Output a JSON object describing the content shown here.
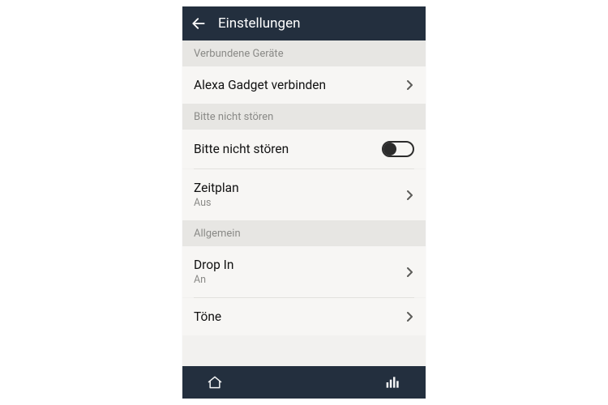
{
  "header": {
    "title": "Einstellungen"
  },
  "sections": {
    "connected": {
      "header": "Verbundene Geräte",
      "gadget_label": "Alexa Gadget verbinden"
    },
    "dnd": {
      "header": "Bitte nicht stören",
      "dnd_label": "Bitte nicht stören",
      "dnd_enabled": false,
      "schedule_label": "Zeitplan",
      "schedule_value": "Aus"
    },
    "general": {
      "header": "Allgemein",
      "dropin_label": "Drop In",
      "dropin_value": "An",
      "tones_label": "Töne"
    }
  }
}
